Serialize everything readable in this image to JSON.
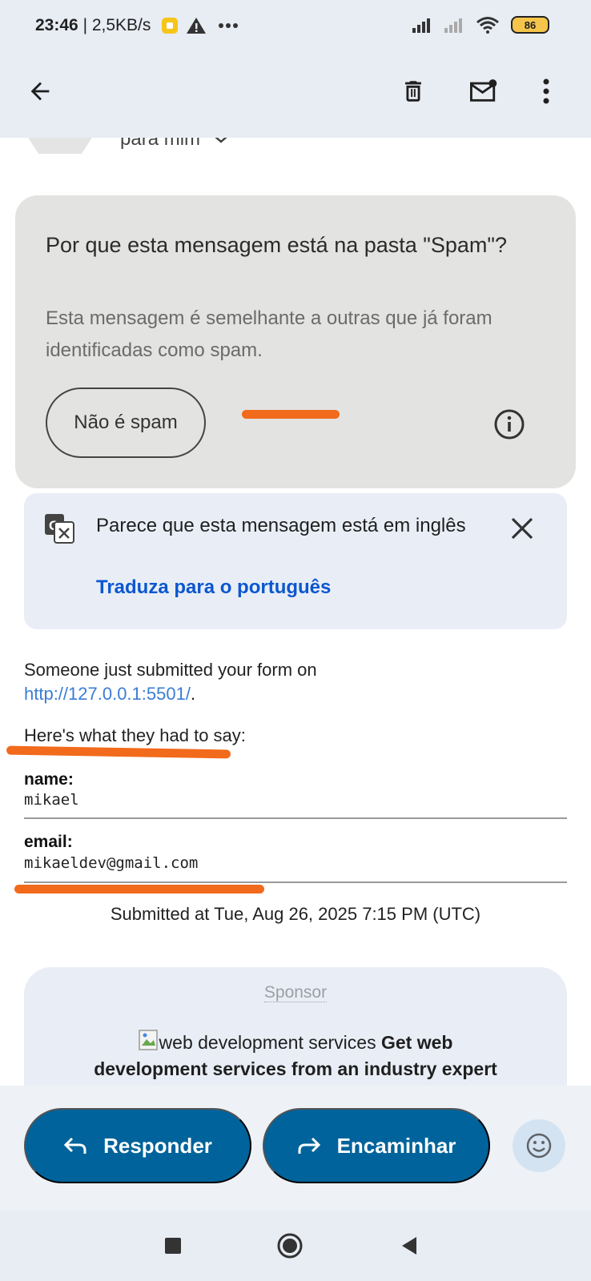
{
  "status_bar": {
    "time": "23:46",
    "net_speed": "| 2,5KB/s",
    "battery": "86"
  },
  "app_bar": {
    "icons": [
      "back-arrow-icon",
      "delete-icon",
      "mark-unread-icon",
      "more-vert-icon"
    ]
  },
  "header": {
    "recipient": "para mim"
  },
  "spam_notice": {
    "title": "Por que esta mensagem está na pasta \"Spam\"?",
    "description": "Esta mensagem é semelhante a outras que já foram identificadas como spam.",
    "not_spam_label": "Não é spam"
  },
  "translate": {
    "message": "Parece que esta mensagem está em inglês",
    "link": "Traduza para o português"
  },
  "email": {
    "intro": "Someone just submitted your form on",
    "url": "http://127.0.0.1:5501/",
    "url_suffix": ".",
    "lead": "Here's what they had to say:",
    "fields": [
      {
        "label": "name:",
        "value": "mikael"
      },
      {
        "label": "email:",
        "value": "mikaeldev@gmail.com"
      }
    ],
    "submitted": "Submitted at Tue, Aug 26, 2025 7:15 PM (UTC)"
  },
  "sponsor": {
    "label": "Sponsor",
    "img_alt": "web development services",
    "headline_bold": "Get web",
    "headline_rest": "development services from an industry expert"
  },
  "actions": {
    "reply": "Responder",
    "forward": "Encaminhar"
  },
  "colors": {
    "primary_button": "#00639b",
    "link": "#0b57d0",
    "annotation": "#f26a1b"
  }
}
